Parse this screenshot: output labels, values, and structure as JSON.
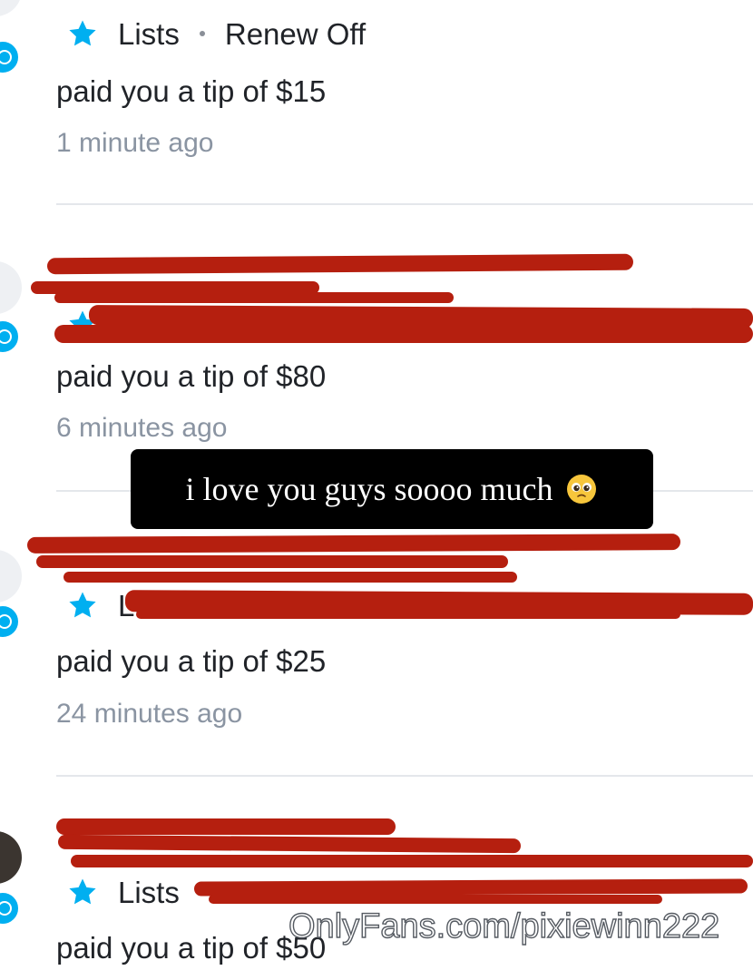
{
  "notifications": [
    {
      "meta": {
        "lists_label": "Lists",
        "renew_label": "Renew Off"
      },
      "tip_text": "paid you a tip of $15",
      "time_text": "1 minute ago"
    },
    {
      "meta": {
        "lists_label": "",
        "renew_label": ""
      },
      "tip_text": "paid you a tip of $80",
      "time_text": "6 minutes ago"
    },
    {
      "meta": {
        "lists_label": "Lists",
        "renew_label": ""
      },
      "tip_text": "paid you a tip of $25",
      "time_text": "24 minutes ago"
    },
    {
      "meta": {
        "lists_label": "Lists",
        "renew_label": ""
      },
      "tip_text": "paid you a tip of $50",
      "time_text": ""
    }
  ],
  "caption": {
    "text": "i love you guys soooo much",
    "emoji": "pleading-face-icon"
  },
  "watermark": {
    "text": "OnlyFans.com/pixiewinn222"
  },
  "colors": {
    "accent": "#00aff0",
    "redaction": "#b51f0f",
    "text_primary": "#202328",
    "text_secondary": "#8a94a2",
    "divider": "#e4e7eb"
  }
}
